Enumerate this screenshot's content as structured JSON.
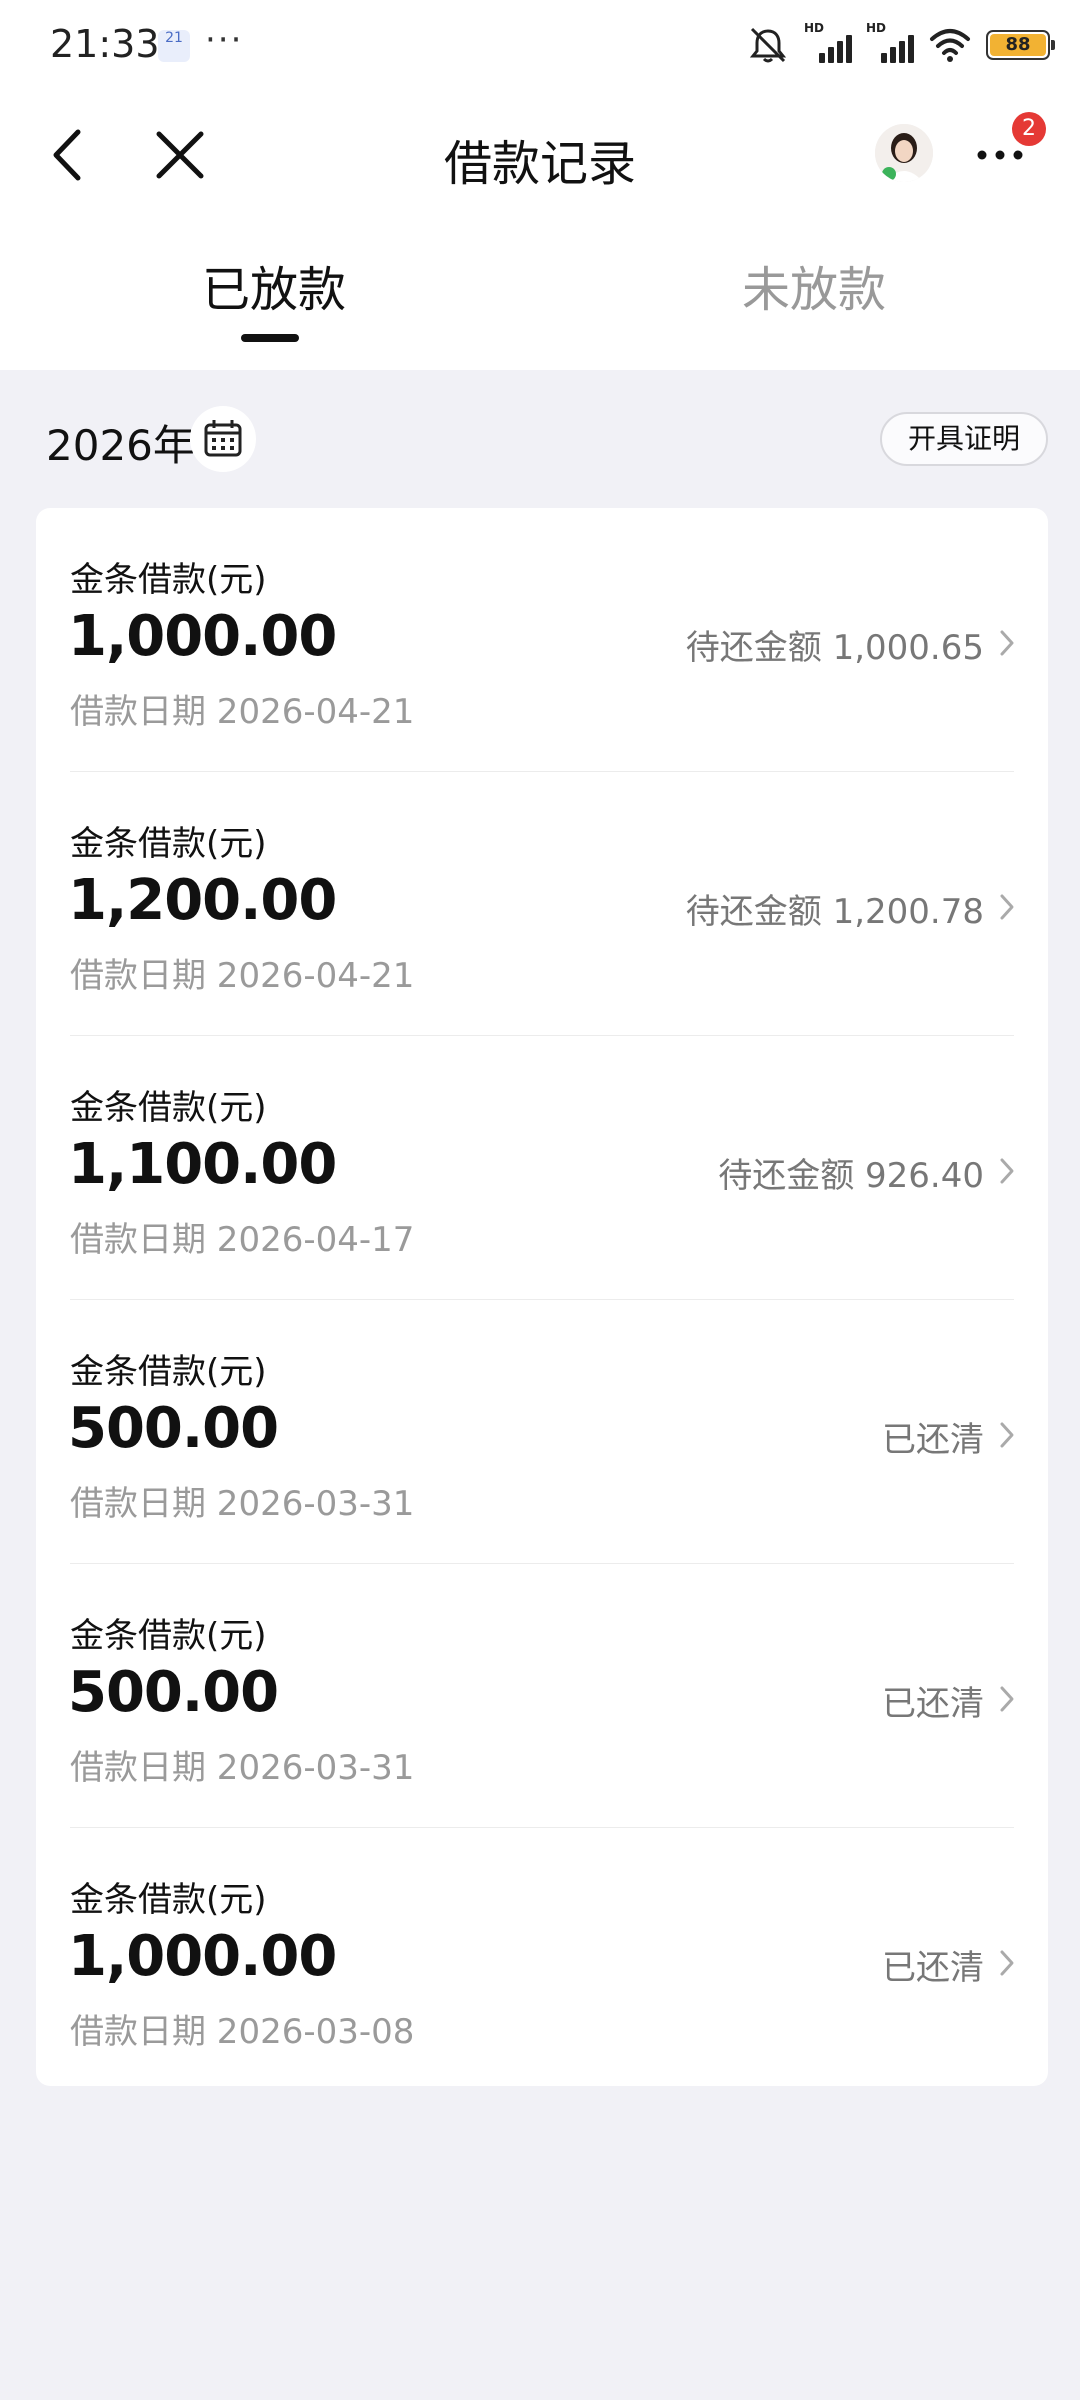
{
  "status_bar": {
    "time": "21:33",
    "calendar_day": "21",
    "more": "···",
    "battery": "88",
    "network": "HD"
  },
  "nav": {
    "title": "借款记录",
    "badge_count": "2"
  },
  "tabs": [
    {
      "label": "已放款",
      "active": true
    },
    {
      "label": "未放款",
      "active": false
    }
  ],
  "filter": {
    "year": "2026年",
    "certificate_button": "开具证明"
  },
  "records": [
    {
      "label": "金条借款(元)",
      "amount": "1,000.00",
      "date": "借款日期 2026-04-21",
      "status": "待还金额 1,000.65"
    },
    {
      "label": "金条借款(元)",
      "amount": "1,200.00",
      "date": "借款日期 2026-04-21",
      "status": "待还金额 1,200.78"
    },
    {
      "label": "金条借款(元)",
      "amount": "1,100.00",
      "date": "借款日期 2026-04-17",
      "status": "待还金额 926.40"
    },
    {
      "label": "金条借款(元)",
      "amount": "500.00",
      "date": "借款日期 2026-03-31",
      "status": "已还清"
    },
    {
      "label": "金条借款(元)",
      "amount": "500.00",
      "date": "借款日期 2026-03-31",
      "status": "已还清"
    },
    {
      "label": "金条借款(元)",
      "amount": "1,000.00",
      "date": "借款日期 2026-03-08",
      "status": "已还清"
    }
  ],
  "colors": {
    "background": "#f1f1f6",
    "card": "#ffffff",
    "badge": "#e53935",
    "battery": "#f2b233",
    "muted_text": "#9a9a9a"
  }
}
